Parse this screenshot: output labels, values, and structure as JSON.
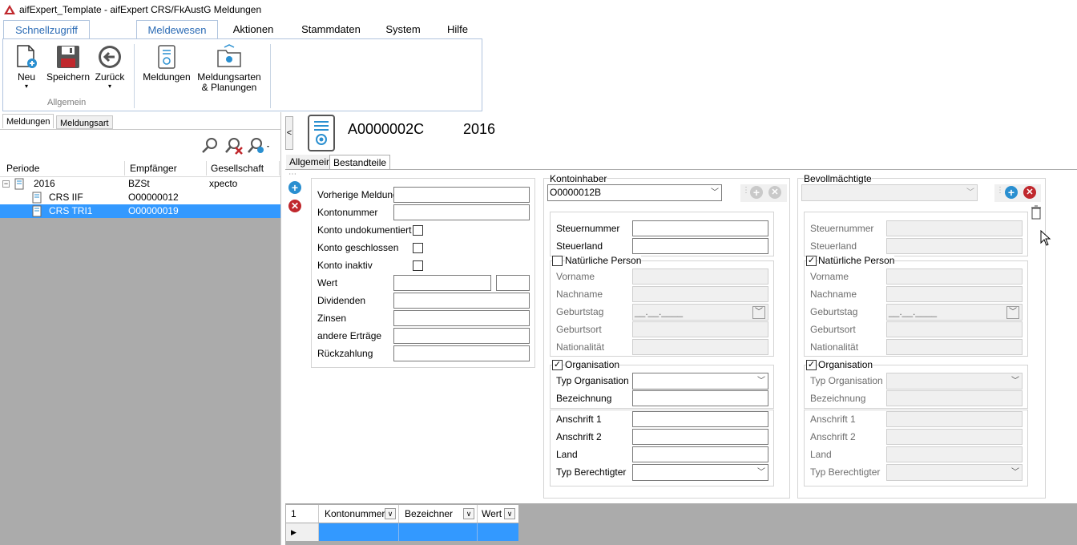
{
  "app": {
    "title": "aifExpert_Template - aifExpert CRS/FkAustG Meldungen"
  },
  "ribbon": {
    "tabs": [
      "Schnellzugriff",
      "Meldewesen",
      "Aktionen",
      "Stammdaten",
      "System",
      "Hilfe"
    ],
    "buttons": {
      "neu": "Neu",
      "speichern": "Speichern",
      "zurueck": "Zurück",
      "meldungen": "Meldungen",
      "meldungsarten_l1": "Meldungsarten",
      "meldungsarten_l2": "& Planungen"
    },
    "group_allgemein": "Allgemein"
  },
  "left": {
    "tabs": [
      "Meldungen",
      "Meldungsart"
    ],
    "columns": [
      "Periode",
      "Empfänger",
      "Gesellschaft"
    ],
    "rows": [
      {
        "periode": "2016",
        "empfaenger": "BZSt",
        "gesellschaft": "xpecto"
      },
      {
        "periode": "CRS IIF",
        "empfaenger": "O00000012",
        "gesellschaft": ""
      },
      {
        "periode": "CRS TRI1",
        "empfaenger": "O00000019",
        "gesellschaft": ""
      }
    ]
  },
  "detail": {
    "collapse_glyph": "<",
    "id": "A0000002C",
    "year": "2016",
    "tabs": [
      "Allgemein",
      "Bestandteile"
    ]
  },
  "konto": {
    "vorherige_meldung": "Vorherige Meldung",
    "kontonummer": "Kontonummer",
    "undokumentiert": "Konto undokumentiert",
    "geschlossen": "Konto geschlossen",
    "inaktiv": "Konto inaktiv",
    "wert": "Wert",
    "dividenden": "Dividenden",
    "zinsen": "Zinsen",
    "andere": "andere Erträge",
    "rueckzahlung": "Rückzahlung"
  },
  "inhaber": {
    "title": "Kontoinhaber",
    "selected": "O0000012B",
    "steuernummer": "Steuernummer",
    "steuerland": "Steuerland",
    "natuerliche_person": "Natürliche Person",
    "natuerliche_checked": "",
    "vorname": "Vorname",
    "nachname": "Nachname",
    "geburtstag": "Geburtstag",
    "geburtstag_value": "__.__.____",
    "geburtsort": "Geburtsort",
    "nationalitaet": "Nationalität",
    "organisation": "Organisation",
    "organisation_checked": "✓",
    "typ_organisation": "Typ Organisation",
    "bezeichnung": "Bezeichnung",
    "anschrift1": "Anschrift 1",
    "anschrift2": "Anschrift 2",
    "land": "Land",
    "typ_berechtigter": "Typ Berechtigter"
  },
  "bevoll": {
    "title": "Bevollmächtigte",
    "steuernummer": "Steuernummer",
    "steuerland": "Steuerland",
    "natuerliche_person": "Natürliche Person",
    "natuerliche_checked": "✓",
    "vorname": "Vorname",
    "nachname": "Nachname",
    "geburtstag": "Geburtstag",
    "geburtstag_value": "__.__.____",
    "geburtsort": "Geburtsort",
    "nationalitaet": "Nationalität",
    "organisation": "Organisation",
    "organisation_checked": "✓",
    "typ_organisation": "Typ Organisation",
    "bezeichnung": "Bezeichnung",
    "anschrift1": "Anschrift 1",
    "anschrift2": "Anschrift 2",
    "land": "Land",
    "typ_berechtigter": "Typ Berechtigter"
  },
  "grid": {
    "row_num": "1",
    "columns": [
      "Kontonummer",
      "Bezeichner",
      "Wert"
    ]
  }
}
